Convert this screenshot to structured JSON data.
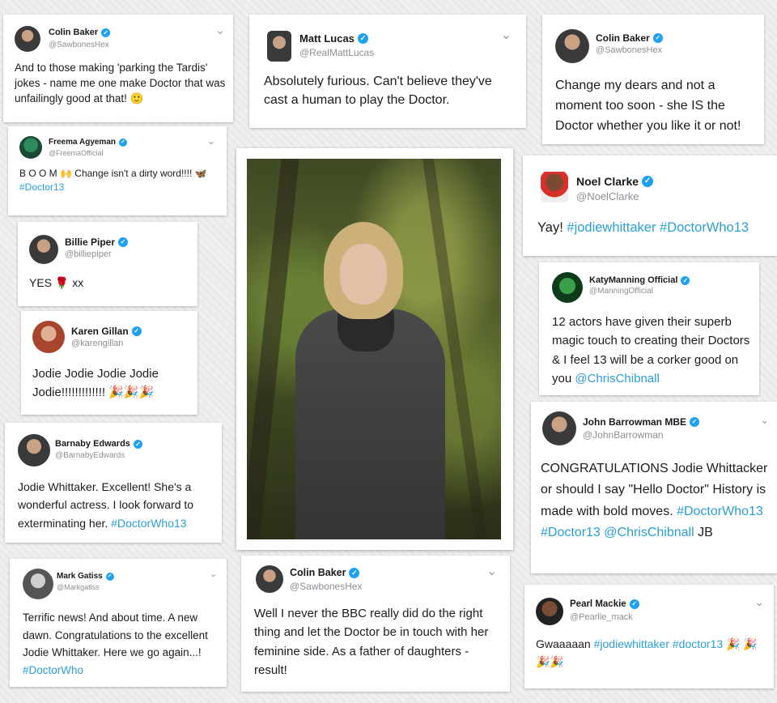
{
  "tweets": [
    {
      "name": "Colin Baker",
      "handle": "@SawbonesHex",
      "text": "And to those making 'parking the Tardis' jokes - name me one make Doctor that was unfailingly good at that! 🙂"
    },
    {
      "name": "Matt Lucas",
      "handle": "@RealMattLucas",
      "text": "Absolutely furious. Can't believe they've cast a human to play the Doctor."
    },
    {
      "name": "Colin Baker",
      "handle": "@SawbonesHex",
      "text": "Change my dears and not a moment too soon - she IS the Doctor whether you like it or not!"
    },
    {
      "name": "Freema Agyeman",
      "handle": "@FreemaOfficial",
      "text_pre": "B O O M 🙌 Change isn't a dirty word!!!! 🦋 ",
      "tag": "#Doctor13"
    },
    {
      "name": "Noel Clarke",
      "handle": "@NoelClarke",
      "text_pre": "Yay! ",
      "tag": "#jodiewhittaker #DoctorWho13"
    },
    {
      "name": "Billie Piper",
      "handle": "@billiepiper",
      "text": "YES 🌹 xx"
    },
    {
      "name": "KatyManning Official",
      "handle": "@ManningOfficial",
      "text_pre": "12 actors have given their superb magic touch to creating their Doctors & I feel 13 will be a corker good on you ",
      "tag": "@ChrisChibnall"
    },
    {
      "name": "Karen Gillan",
      "handle": "@karengillan",
      "text": "Jodie Jodie Jodie Jodie Jodie!!!!!!!!!!!!! 🎉🎉🎉"
    },
    {
      "name": "John Barrowman MBE",
      "handle": "@JohnBarrowman",
      "text_pre": "CONGRATULATIONS Jodie Whittacker or should I say \"Hello Doctor\" History is made with bold moves. ",
      "tag": "#DoctorWho13 #Doctor13 @ChrisChibnall",
      "text_post": " JB"
    },
    {
      "name": "Barnaby Edwards",
      "handle": "@BarnabyEdwards",
      "text_pre": "Jodie Whittaker. Excellent! She's a wonderful actress. I look forward to exterminating her. ",
      "tag": "#DoctorWho13"
    },
    {
      "name": "Mark Gatiss",
      "handle": "@Markgatiss",
      "text_pre": "Terrific news! And about time. A new dawn. Congratulations to the excellent Jodie Whittaker. Here we go again...! ",
      "tag": "#DoctorWho"
    },
    {
      "name": "Colin Baker",
      "handle": "@SawbonesHex",
      "text": "Well I never the BBC really did do the right thing and let the Doctor be in touch with her feminine side. As a father of daughters - result!"
    },
    {
      "name": "Pearl Mackie",
      "handle": "@Pearlie_mack",
      "text_pre": "Gwaaaaan ",
      "tag": "#jodiewhittaker #doctor13",
      "text_post": " 🎉 🎉🎉🎉"
    }
  ],
  "colors": {
    "link": "#2a9fd6",
    "verified": "#1da1f2"
  },
  "icons": {
    "verified": "✓",
    "chevron": "⌄"
  }
}
